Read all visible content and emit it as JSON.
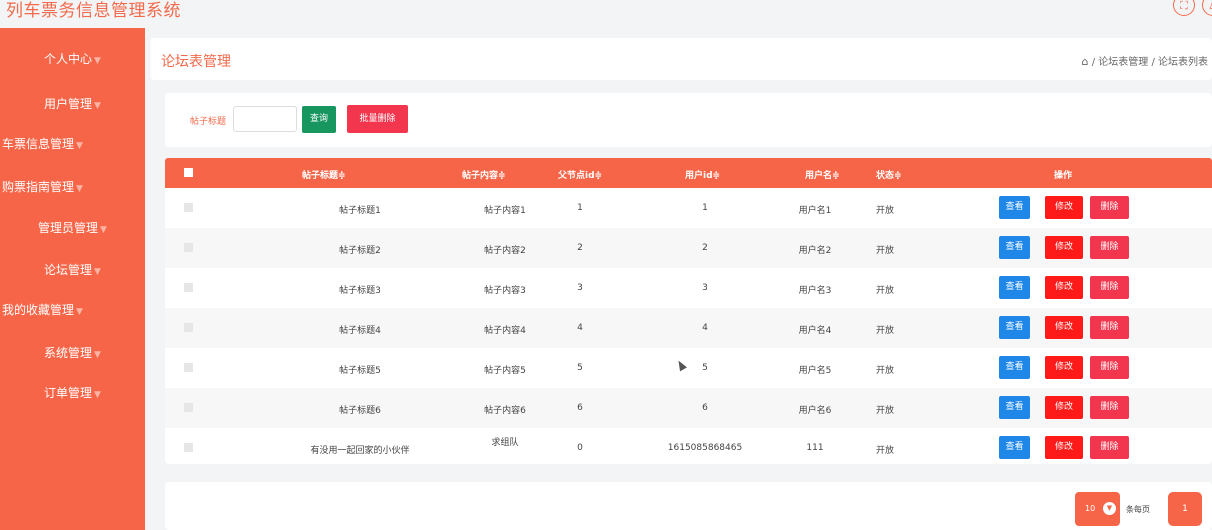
{
  "app": {
    "title": "列车票务信息管理系统"
  },
  "top_icons": [
    {
      "icon": "fullscreen-icon",
      "glyph": "⛶"
    },
    {
      "icon": "user-icon",
      "glyph": "♙"
    }
  ],
  "sidebar": {
    "items": [
      {
        "label": "个人中心"
      },
      {
        "label": "用户管理"
      },
      {
        "label": "车票信息管理"
      },
      {
        "label": "购票指南管理"
      },
      {
        "label": "管理员管理"
      },
      {
        "label": "论坛管理"
      },
      {
        "label": "我的收藏管理"
      },
      {
        "label": "系统管理"
      },
      {
        "label": "订单管理"
      }
    ]
  },
  "header": {
    "title": "论坛表管理",
    "breadcrumb": [
      "论坛表管理",
      "论坛表列表"
    ],
    "separator": "/"
  },
  "search": {
    "label": "帖子标题",
    "value": "",
    "query_button": "查询",
    "batch_delete_button": "批量删除"
  },
  "table": {
    "columns": [
      "帖子标题",
      "帖子内容",
      "父节点id",
      "用户id",
      "用户名",
      "状态",
      "操作"
    ],
    "sort_mark": "≑",
    "rows": [
      {
        "title": "帖子标题1",
        "content": "帖子内容1",
        "parent_id": "1",
        "user_id": "1",
        "username": "用户名1",
        "status": "开放"
      },
      {
        "title": "帖子标题2",
        "content": "帖子内容2",
        "parent_id": "2",
        "user_id": "2",
        "username": "用户名2",
        "status": "开放"
      },
      {
        "title": "帖子标题3",
        "content": "帖子内容3",
        "parent_id": "3",
        "user_id": "3",
        "username": "用户名3",
        "status": "开放"
      },
      {
        "title": "帖子标题4",
        "content": "帖子内容4",
        "parent_id": "4",
        "user_id": "4",
        "username": "用户名4",
        "status": "开放"
      },
      {
        "title": "帖子标题5",
        "content": "帖子内容5",
        "parent_id": "5",
        "user_id": "5",
        "username": "用户名5",
        "status": "开放"
      },
      {
        "title": "帖子标题6",
        "content": "帖子内容6",
        "parent_id": "6",
        "user_id": "6",
        "username": "用户名6",
        "status": "开放"
      },
      {
        "title": "有没用一起回家的小伙伴",
        "content": "求组队",
        "parent_id": "0",
        "user_id": "1615085868465",
        "username": "111",
        "status": "开放"
      }
    ],
    "actions": {
      "view": "查看",
      "edit": "修改",
      "delete": "删除"
    }
  },
  "pagination": {
    "page_size": "10",
    "per_page_label": "条每页",
    "current_page": "1"
  },
  "colors": {
    "accent": "#f76548",
    "title": "#f26a4b",
    "query": "#17965f",
    "view": "#1f87e8",
    "edit": "#ff1a1a",
    "delete": "#f2364e"
  }
}
